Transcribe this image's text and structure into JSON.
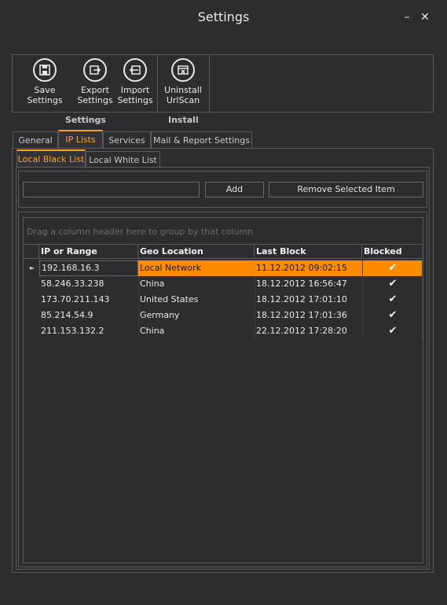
{
  "window": {
    "title": "Settings",
    "minimize": "–",
    "close": "✕"
  },
  "ribbon": {
    "buttons": [
      {
        "label1": "Save Settings",
        "label2": "",
        "icon": "save-icon"
      },
      {
        "label1": "Export",
        "label2": "Settings",
        "icon": "export-icon"
      },
      {
        "label1": "Import",
        "label2": "Settings",
        "icon": "import-icon"
      },
      {
        "label1": "Uninstall",
        "label2": "UrlScan",
        "icon": "uninstall-icon"
      }
    ],
    "groups": [
      "Settings",
      "Install"
    ]
  },
  "tabs": [
    "General",
    "IP Lists",
    "Services",
    "Mail & Report Settings"
  ],
  "subtabs": [
    "Local Black List",
    "Local White List"
  ],
  "entry": {
    "value": "",
    "add_label": "Add",
    "remove_label": "Remove Selected Item"
  },
  "grid": {
    "group_hint": "Drag a column header here to group by that column",
    "columns": [
      "IP or Range",
      "Geo Location",
      "Last Block",
      "Blocked"
    ],
    "rows": [
      {
        "ip": "192.168.16.3",
        "geo": "Local Network",
        "last": "11.12.2012 09:02:15",
        "blocked": "✔"
      },
      {
        "ip": "58.246.33.238",
        "geo": "China",
        "last": "18.12.2012 16:56:47",
        "blocked": "✔"
      },
      {
        "ip": "173.70.211.143",
        "geo": "United States",
        "last": "18.12.2012 17:01:10",
        "blocked": "✔"
      },
      {
        "ip": "85.214.54.9",
        "geo": "Germany",
        "last": "18.12.2012 17:01:36",
        "blocked": "✔"
      },
      {
        "ip": "211.153.132.2",
        "geo": "China",
        "last": "22.12.2012 17:28:20",
        "blocked": "✔"
      }
    ],
    "row_indicator": "►"
  },
  "colors": {
    "accent": "#f5a623",
    "selected_row": "#fb8c00",
    "background": "#2d2d30"
  }
}
